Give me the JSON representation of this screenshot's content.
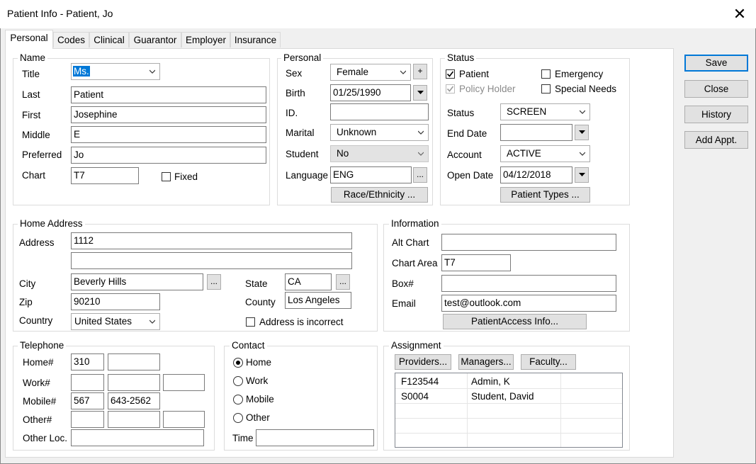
{
  "window": {
    "title": "Patient Info - Patient, Jo",
    "close_glyph": "✕"
  },
  "tabs": [
    "Personal",
    "Codes",
    "Clinical",
    "Guarantor",
    "Employer",
    "Insurance"
  ],
  "actions": {
    "save": "Save",
    "close": "Close",
    "history": "History",
    "add_appt": "Add Appt."
  },
  "name": {
    "legend": "Name",
    "title_label": "Title",
    "title_value": "Ms.",
    "last_label": "Last",
    "last_value": "Patient",
    "first_label": "First",
    "first_value": "Josephine",
    "middle_label": "Middle",
    "middle_value": "E",
    "preferred_label": "Preferred",
    "preferred_value": "Jo",
    "chart_label": "Chart",
    "chart_value": "T7",
    "fixed_label": "Fixed"
  },
  "personal": {
    "legend": "Personal",
    "sex_label": "Sex",
    "sex_value": "Female",
    "plus": "+",
    "birth_label": "Birth",
    "birth_value": "01/25/1990",
    "id_label": "ID.",
    "id_value": "",
    "marital_label": "Marital",
    "marital_value": "Unknown",
    "student_label": "Student",
    "student_value": "No",
    "language_label": "Language",
    "language_value": "ENG",
    "ellipsis": "...",
    "race_button": "Race/Ethnicity ..."
  },
  "status": {
    "legend": "Status",
    "patient_label": "Patient",
    "policy_holder_label": "Policy Holder",
    "emergency_label": "Emergency",
    "special_needs_label": "Special Needs",
    "status_label": "Status",
    "status_value": "SCREEN",
    "end_date_label": "End Date",
    "end_date_value": "",
    "account_label": "Account",
    "account_value": "ACTIVE",
    "open_date_label": "Open Date",
    "open_date_value": "04/12/2018",
    "patient_types_button": "Patient Types ..."
  },
  "home_address": {
    "legend": "Home Address",
    "address_label": "Address",
    "address1_value": "1112",
    "address2_value": "",
    "city_label": "City",
    "city_value": "Beverly Hills",
    "state_label": "State",
    "state_value": "CA",
    "zip_label": "Zip",
    "zip_value": "90210",
    "county_label": "County",
    "county_value": "Los Angeles",
    "country_label": "Country",
    "country_value": "United States",
    "incorrect_label": "Address is incorrect",
    "ellipsis": "..."
  },
  "information": {
    "legend": "Information",
    "alt_chart_label": "Alt Chart",
    "alt_chart_value": "",
    "chart_area_label": "Chart Area",
    "chart_area_value": "T7",
    "box_label": "Box#",
    "box_value": "",
    "email_label": "Email",
    "email_value": "test@outlook.com",
    "patient_access_button": "PatientAccess Info..."
  },
  "telephone": {
    "legend": "Telephone",
    "home_label": "Home#",
    "home_area": "310",
    "home_number": "",
    "work_label": "Work#",
    "work_area": "",
    "work_number": "",
    "work_ext": "",
    "mobile_label": "Mobile#",
    "mobile_area": "567",
    "mobile_number": "643-2562",
    "other_label": "Other#",
    "other_area": "",
    "other_number": "",
    "other_ext": "",
    "other_loc_label": "Other Loc.",
    "other_loc_value": ""
  },
  "contact": {
    "legend": "Contact",
    "home": "Home",
    "work": "Work",
    "mobile": "Mobile",
    "other": "Other",
    "time_label": "Time",
    "time_value": ""
  },
  "assignment": {
    "legend": "Assignment",
    "providers_button": "Providers...",
    "managers_button": "Managers...",
    "faculty_button": "Faculty...",
    "rows": [
      {
        "code": "F123544",
        "name": "Admin, K"
      },
      {
        "code": "S0004",
        "name": "Student, David"
      }
    ]
  }
}
